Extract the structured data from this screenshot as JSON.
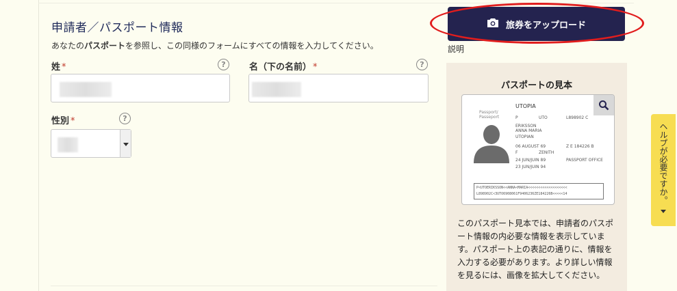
{
  "section": {
    "title": "申請者／パスポート情報",
    "intro_pre": "あなたの",
    "intro_bold": "パスポート",
    "intro_post": "を参照し、この同様のフォームにすべての情報を入力してください。"
  },
  "fields": {
    "surname": {
      "label": "姓",
      "required": "*",
      "value": ""
    },
    "given_name": {
      "label": "名（下の名前）",
      "required": "*",
      "value": ""
    },
    "gender": {
      "label": "性別",
      "required": "*",
      "value": ""
    }
  },
  "help_glyph": "?",
  "upload": {
    "label": "旅券をアップロード",
    "icon": "camera-icon"
  },
  "description_link": "説明",
  "sample": {
    "title": "パスポートの見本",
    "passport": {
      "country_title": "UTOPIA",
      "header_left_1": "Passport/",
      "header_left_2": "Passeport",
      "type": "P",
      "code": "UTO",
      "number": "L898902 C",
      "surname": "ERIKSSON",
      "given_names": "ANNA MARIA",
      "nationality": "UTOPIAN",
      "dob": "06 AUGUST 69",
      "personal_no": "Z E 184226 B",
      "sex": "F",
      "place_of_birth": "ZENITH",
      "date_of_issue": "24 JUN/JUIN 89",
      "authority": "PASSPORT OFFICE",
      "date_of_expiry": "23 JUN/JUIN 94",
      "mrz_1": "P<UTOERIKSSON<<ANNA<MARIA<<<<<<<<<<<<<<<<<<<",
      "mrz_2": "L898902C<3UTO6908061F9406236ZE184226B<<<<<14"
    },
    "description": "このパスポート見本では、申請者のパスポート情報の内必要な情報を表示しています。パスポート上の表記の通りに、情報を入力する必要があります。より詳しい情報を見るには、画像を拡大してください。"
  },
  "help_tab": {
    "label": "ヘルプが必要ですか。"
  },
  "colors": {
    "accent": "#24234f",
    "highlight": "#e11d1d",
    "help_tab": "#f7dd52"
  }
}
